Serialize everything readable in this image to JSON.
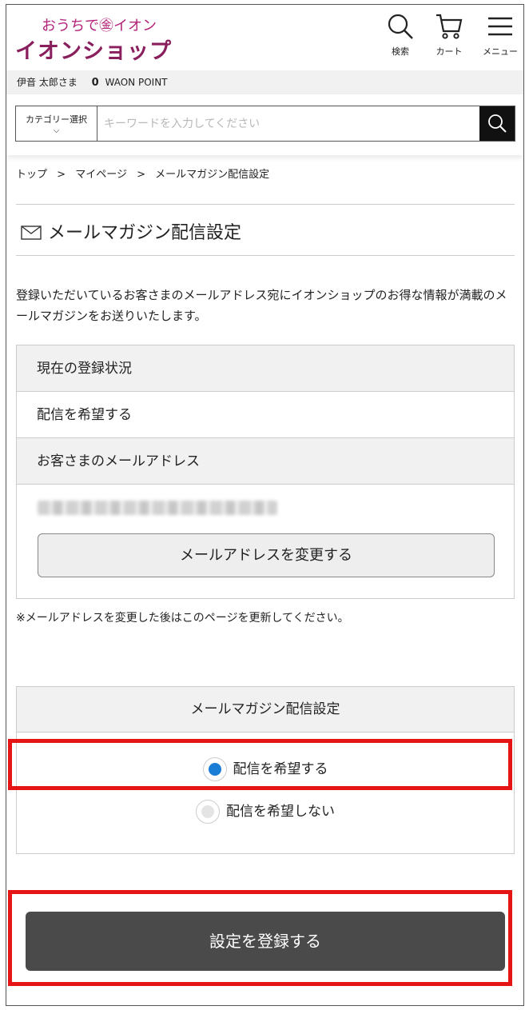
{
  "header": {
    "logo_top": "おうちで㊎イオン",
    "logo_main": "イオンショップ",
    "search_label": "検索",
    "cart_label": "カート",
    "menu_label": "メニュー"
  },
  "userbar": {
    "user_name": "伊音 太郎さま",
    "points": "0",
    "points_label": "WAON POINT"
  },
  "search": {
    "category_label": "カテゴリー選択",
    "category_chevron": "⌵",
    "placeholder": "キーワードを入力してください"
  },
  "breadcrumb": {
    "items": [
      "トップ",
      "マイページ",
      "メールマガジン配信設定"
    ],
    "separator": ">"
  },
  "page": {
    "title": "メールマガジン配信設定",
    "intro": "登録いただいているお客さまのメールアドレス宛にイオンショップのお得な情報が満載のメールマガジンをお送りいたします。"
  },
  "status_box": {
    "status_header": "現在の登録状況",
    "status_value": "配信を希望する",
    "email_header": "お客さまのメールアドレス",
    "change_email_button": "メールアドレスを変更する"
  },
  "note": "※メールアドレスを変更した後はこのページを更新してください。",
  "settings_box": {
    "header": "メールマガジン配信設定",
    "options": [
      {
        "label": "配信を希望する",
        "selected": true
      },
      {
        "label": "配信を希望しない",
        "selected": false
      }
    ]
  },
  "submit_button": "設定を登録する",
  "colors": {
    "brand": "#8a1f5e",
    "radio_selected": "#1a7ed6",
    "highlight": "#e51515",
    "submit_bg": "#4a4a4a"
  }
}
